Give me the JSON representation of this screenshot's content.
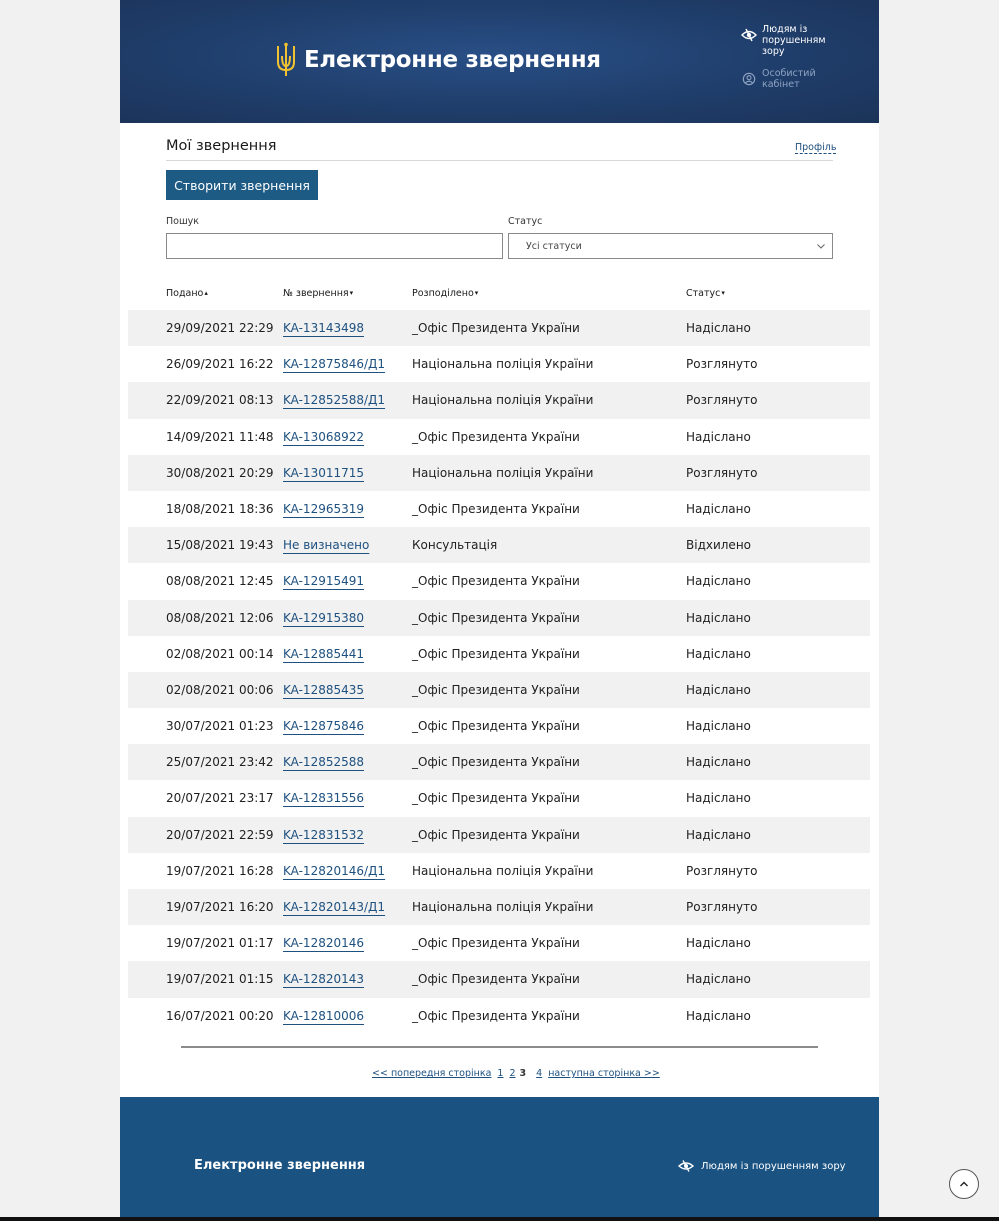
{
  "header": {
    "logo_text": "Електронне звернення",
    "visually_impaired": "Людям із порушенням зору",
    "cabinet": "Особистий кабінет"
  },
  "page": {
    "title": "Мої звернення",
    "profile_link": "Профіль",
    "create_button": "Створити звернення"
  },
  "filters": {
    "search_label": "Пошук",
    "search_value": "",
    "status_label": "Статус",
    "status_value": "Усі статуси"
  },
  "table": {
    "headers": [
      "Подано",
      "№ звернення",
      "Розподілено",
      "Статус"
    ],
    "rows": [
      {
        "date": "29/09/2021 22:29",
        "number": "KA-13143498",
        "org": "_Офіс Президента України",
        "status": "Надіслано"
      },
      {
        "date": "26/09/2021 16:22",
        "number": "KA-12875846/Д1",
        "org": "Національна поліція України",
        "status": "Розглянуто"
      },
      {
        "date": "22/09/2021 08:13",
        "number": "KA-12852588/Д1",
        "org": "Національна поліція України",
        "status": "Розглянуто"
      },
      {
        "date": "14/09/2021 11:48",
        "number": "KA-13068922",
        "org": "_Офіс Президента України",
        "status": "Надіслано"
      },
      {
        "date": "30/08/2021 20:29",
        "number": "KA-13011715",
        "org": "Національна поліція України",
        "status": "Розглянуто"
      },
      {
        "date": "18/08/2021 18:36",
        "number": "KA-12965319",
        "org": "_Офіс Президента України",
        "status": "Надіслано"
      },
      {
        "date": "15/08/2021 19:43",
        "number": "Не визначено",
        "org": "Консультація",
        "status": "Відхилено"
      },
      {
        "date": "08/08/2021 12:45",
        "number": "KA-12915491",
        "org": "_Офіс Президента України",
        "status": "Надіслано"
      },
      {
        "date": "08/08/2021 12:06",
        "number": "KA-12915380",
        "org": "_Офіс Президента України",
        "status": "Надіслано"
      },
      {
        "date": "02/08/2021 00:14",
        "number": "KA-12885441",
        "org": "_Офіс Президента України",
        "status": "Надіслано"
      },
      {
        "date": "02/08/2021 00:06",
        "number": "KA-12885435",
        "org": "_Офіс Президента України",
        "status": "Надіслано"
      },
      {
        "date": "30/07/2021 01:23",
        "number": "KA-12875846",
        "org": "_Офіс Президента України",
        "status": "Надіслано"
      },
      {
        "date": "25/07/2021 23:42",
        "number": "KA-12852588",
        "org": "_Офіс Президента України",
        "status": "Надіслано"
      },
      {
        "date": "20/07/2021 23:17",
        "number": "KA-12831556",
        "org": "_Офіс Президента України",
        "status": "Надіслано"
      },
      {
        "date": "20/07/2021 22:59",
        "number": "KA-12831532",
        "org": "_Офіс Президента України",
        "status": "Надіслано"
      },
      {
        "date": "19/07/2021 16:28",
        "number": "KA-12820146/Д1",
        "org": "Національна поліція України",
        "status": "Розглянуто"
      },
      {
        "date": "19/07/2021 16:20",
        "number": "KA-12820143/Д1",
        "org": "Національна поліція України",
        "status": "Розглянуто"
      },
      {
        "date": "19/07/2021 01:17",
        "number": "KA-12820146",
        "org": "_Офіс Президента України",
        "status": "Надіслано"
      },
      {
        "date": "19/07/2021 01:15",
        "number": "KA-12820143",
        "org": "_Офіс Президента України",
        "status": "Надіслано"
      },
      {
        "date": "16/07/2021 00:20",
        "number": "KA-12810006",
        "org": "_Офіс Президента України",
        "status": "Надіслано"
      }
    ]
  },
  "pagination": {
    "prev": "<< попередня сторінка",
    "pages_before": [
      "1",
      "2"
    ],
    "current": "3",
    "pages_after": [
      "4"
    ],
    "next": "наступна сторінка >>"
  },
  "footer": {
    "title": "Електронне звернення",
    "visually_impaired": "Людям із порушенням зору"
  },
  "colors": {
    "header_bg": "#203f6d",
    "footer_bg": "#1a5282",
    "accent": "#1d5a84",
    "link": "#1e5180",
    "trident": "#f2c230"
  },
  "icons": [
    "trident-icon",
    "eye-icon",
    "user-circle-icon",
    "chevron-down-icon",
    "arrow-up-icon"
  ]
}
